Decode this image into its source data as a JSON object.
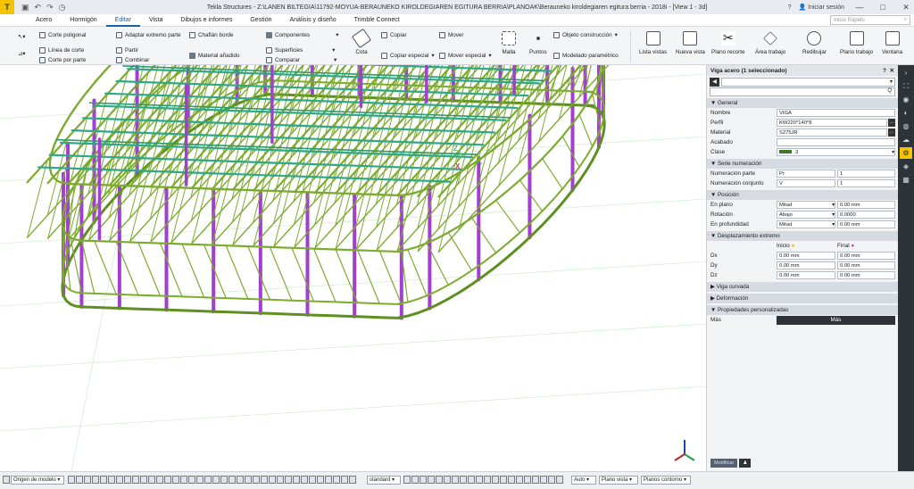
{
  "titlebar": {
    "logo": "T",
    "title": "Tekla Structures - Z:\\LANEN BILTEGIA\\11792-MOYUA-BERAUNEKO KIROLDEGIAREN EGITURA BERRIA\\PLANOAK\\Berauneko kiroldegiaren egitura berria - 2018i - [View 1 - 3d]",
    "help": "?",
    "login": "Iniciar sesión",
    "minimize": "—",
    "maximize": "□",
    "close": "✕",
    "quick_search": "Inicio Rápido"
  },
  "menu": {
    "tabs": [
      "Acero",
      "Hormigón",
      "Editar",
      "Vista",
      "Dibujos e informes",
      "Gestión",
      "Análisis y diseño",
      "Trimble Connect"
    ],
    "active": "Editar"
  },
  "ribbon": {
    "corte_poligonal": "Corte poligonal",
    "linea_corte": "Línea de corte",
    "corte_por_parte": "Corte por parte",
    "adaptar": "Adaptar extremo parte",
    "partir": "Partir",
    "combinar": "Combinar",
    "chaflan": "Chaflán borde",
    "material": "Material añadido",
    "componentes": "Componentes",
    "superficies": "Superficies",
    "comparar": "Comparar",
    "cota": "Cota",
    "copiar": "Copiar",
    "copiar_especial": "Copiar especial",
    "mover": "Mover",
    "mover_especial": "Mover especial",
    "malla": "Malla",
    "puntos": "Puntos",
    "objeto": "Objeto construcción",
    "modelado": "Modelado paramétrico",
    "lista_vistas": "Lista vistas",
    "nueva_vista": "Nueva vista",
    "plano_recorte": "Plano recorte",
    "area_trabajo": "Área trabajo",
    "redibujar": "Redibujar",
    "plano_trabajo": "Plano trabajo",
    "ventana": "Ventana"
  },
  "panel": {
    "title": "Viga acero (1 seleccionado)",
    "help": "?",
    "close": "✕",
    "search": "Q",
    "general": "General",
    "nombre_lbl": "Nombre",
    "nombre": "VIGA",
    "perfil_lbl": "Perfil",
    "perfil": "KW220*140*8",
    "material_lbl": "Material",
    "material": "S275JR",
    "acabado_lbl": "Acabado",
    "acabado": "",
    "clase_lbl": "Clase",
    "clase": "3",
    "serie": "Serie numeración",
    "num_parte_lbl": "Numeración parte",
    "num_parte_pref": "Pr",
    "num_parte": "1",
    "num_conj_lbl": "Numeración conjunto",
    "num_conj_pref": "V",
    "num_conj": "1",
    "posicion": "Posición",
    "en_plano_lbl": "En plano",
    "en_plano": "Mitad",
    "en_plano_v": "0.00 mm",
    "rotacion_lbl": "Rotación",
    "rotacion": "Abajo",
    "rotacion_v": "0.0000",
    "profundidad_lbl": "En profundidad",
    "profundidad": "Mitad",
    "profundidad_v": "0.00 mm",
    "desplazamiento": "Desplazamiento extremo",
    "inicio": "Inicio",
    "final": "Final",
    "dx_lbl": "Dx",
    "dy_lbl": "Dy",
    "dz_lbl": "Dz",
    "zero": "0.00 mm",
    "viga_curvada": "Viga curvada",
    "deformacion": "Deformación",
    "propiedades": "Propiedades personalizadas",
    "mas_lbl": "Más",
    "mas": "Más",
    "modificar": "Modificar"
  },
  "status": {
    "origen": "Origen de modelo",
    "standard": "standard",
    "auto": "Auto",
    "plano_vista": "Plano vista",
    "planos_contorno": "Planos contorno"
  },
  "axis": {
    "x": "X",
    "y": "Y",
    "z": "Z"
  },
  "colors": {
    "steel": "#7dab2f",
    "beam": "#2fa888",
    "column": "#a23fd0",
    "accent": "#f5c400"
  }
}
